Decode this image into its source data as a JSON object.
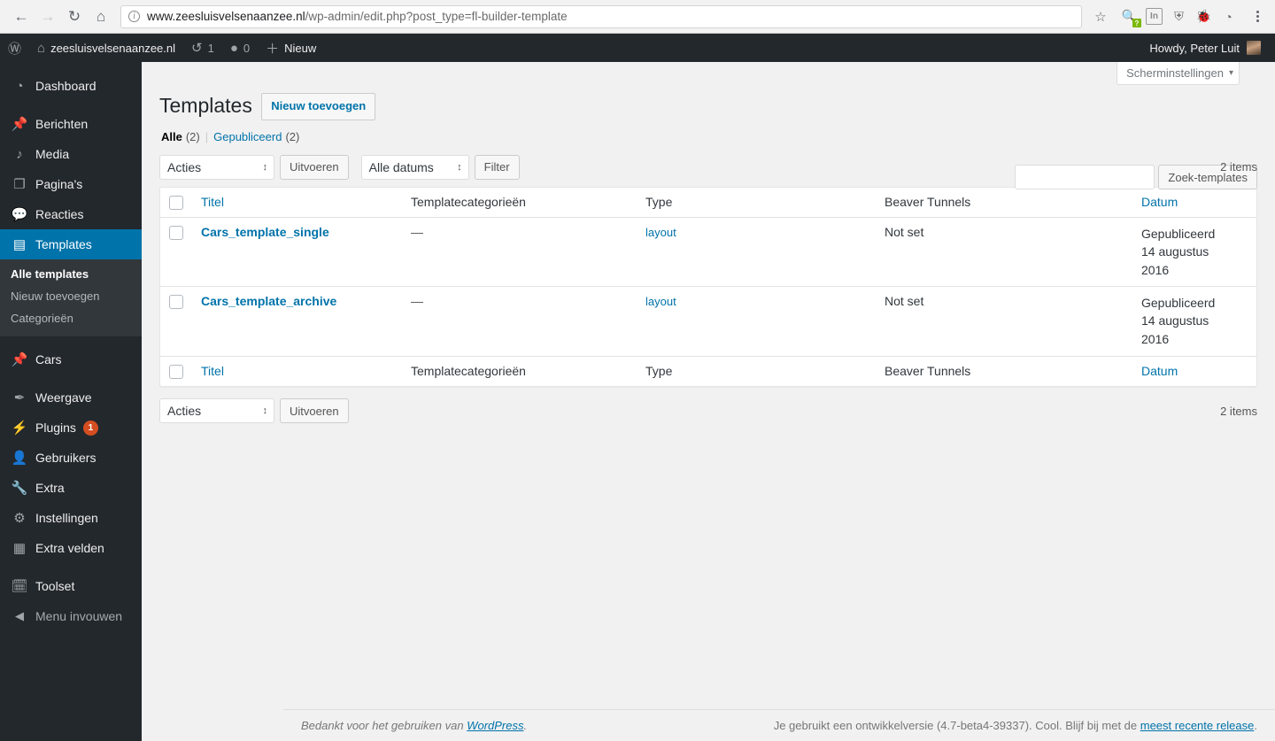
{
  "browser": {
    "back_icon": "←",
    "forward_icon": "→",
    "reload_icon": "↻",
    "home_icon": "⌂",
    "info_icon": "i",
    "url_host": "www.zeesluisvelsenaanzee.nl",
    "url_path": "/wp-admin/edit.php?post_type=fl-builder-template",
    "star_icon": "☆",
    "extensions": [
      {
        "name": "magnifier-extension-icon",
        "glyph": "🔍",
        "badge": "?"
      },
      {
        "name": "linkedin-extension-icon",
        "glyph": "In",
        "badge": ""
      },
      {
        "name": "shield-extension-icon",
        "glyph": "⛨",
        "badge": ""
      },
      {
        "name": "bug-extension-icon",
        "glyph": "🐞",
        "badge": ""
      },
      {
        "name": "globe-extension-icon",
        "glyph": "◔",
        "badge": ""
      }
    ]
  },
  "adminbar": {
    "wp_logo_icon": "Ⓦ",
    "home_icon": "⌂",
    "site_name": "zeesluisvelsenaanzee.nl",
    "updates_icon": "↺",
    "updates_count": "1",
    "comments_icon": "●",
    "comments_count": "0",
    "new_icon": "＋",
    "new_label": "Nieuw",
    "howdy": "Howdy, Peter Luit"
  },
  "sidebar": {
    "items": [
      {
        "label": "Dashboard",
        "icon": "dashboard-icon",
        "glyph": "◔",
        "current": false,
        "gap_after": true
      },
      {
        "label": "Berichten",
        "icon": "pin-icon",
        "glyph": "📌",
        "current": false
      },
      {
        "label": "Media",
        "icon": "media-icon",
        "glyph": "♪",
        "current": false
      },
      {
        "label": "Pagina's",
        "icon": "page-icon",
        "glyph": "❐",
        "current": false
      },
      {
        "label": "Reacties",
        "icon": "comment-icon",
        "glyph": "💬",
        "current": false
      },
      {
        "label": "Templates",
        "icon": "templates-icon",
        "glyph": "▤",
        "current": true
      }
    ],
    "submenu": [
      {
        "label": "Alle templates",
        "current": true
      },
      {
        "label": "Nieuw toevoegen",
        "current": false
      },
      {
        "label": "Categorieën",
        "current": false
      }
    ],
    "items2": [
      {
        "label": "Cars",
        "icon": "pin-icon",
        "glyph": "📌",
        "badge": ""
      },
      {
        "label": "Weergave",
        "icon": "appearance-brush-icon",
        "glyph": "✒",
        "badge": "",
        "gap_before": true
      },
      {
        "label": "Plugins",
        "icon": "plugin-icon",
        "glyph": "⚡",
        "badge": "1"
      },
      {
        "label": "Gebruikers",
        "icon": "user-icon",
        "glyph": "👤",
        "badge": ""
      },
      {
        "label": "Extra",
        "icon": "tools-wrench-icon",
        "glyph": "🔧",
        "badge": ""
      },
      {
        "label": "Instellingen",
        "icon": "settings-sliders-icon",
        "glyph": "⚙",
        "badge": ""
      },
      {
        "label": "Extra velden",
        "icon": "custom-fields-icon",
        "glyph": "▦",
        "badge": ""
      },
      {
        "label": "Toolset",
        "icon": "toolset-icon",
        "glyph": "🗓",
        "badge": "",
        "gap_before": true
      },
      {
        "label": "Menu invouwen",
        "icon": "collapse-arrow-icon",
        "glyph": "◀",
        "badge": "",
        "collapse": true
      }
    ]
  },
  "screen_options": {
    "label": "Scherminstellingen",
    "caret": "▾"
  },
  "page": {
    "title": "Templates",
    "add_new_label": "Nieuw toevoegen"
  },
  "views": {
    "all_label": "Alle",
    "all_count": "(2)",
    "separator": "|",
    "published_label": "Gepubliceerd",
    "published_count": "(2)"
  },
  "search": {
    "value": "",
    "placeholder": "",
    "button_label": "Zoek-templates"
  },
  "tablenav_top": {
    "bulk_action": "Acties",
    "apply_label": "Uitvoeren",
    "date_filter": "Alle datums",
    "filter_label": "Filter",
    "displaying_num": "2 items"
  },
  "tablenav_bottom": {
    "bulk_action": "Acties",
    "apply_label": "Uitvoeren",
    "displaying_num": "2 items"
  },
  "table": {
    "columns": [
      {
        "label": "Titel",
        "link": true
      },
      {
        "label": "Templatecategorieën",
        "link": false
      },
      {
        "label": "Type",
        "link": false
      },
      {
        "label": "Beaver Tunnels",
        "link": false
      },
      {
        "label": "Datum",
        "link": true
      }
    ],
    "rows": [
      {
        "title": "Cars_template_single",
        "categories": "—",
        "type": "layout",
        "beaver_tunnels": "Not set",
        "date_status": "Gepubliceerd",
        "date_day": "14 augustus",
        "date_year": "2016"
      },
      {
        "title": "Cars_template_archive",
        "categories": "—",
        "type": "layout",
        "beaver_tunnels": "Not set",
        "date_status": "Gepubliceerd",
        "date_day": "14 augustus",
        "date_year": "2016"
      }
    ]
  },
  "footer": {
    "thanks_prefix": "Bedankt voor het gebruiken van ",
    "wordpress_link": "WordPress",
    "thanks_suffix": ".",
    "version_text": "Je gebruikt een ontwikkelversie (4.7-beta4-39337). Cool. Blijf bij met de ",
    "release_link": "meest recente release",
    "version_suffix": "."
  },
  "colors": {
    "wp_blue": "#0073aa",
    "sidebar_bg": "#23282d",
    "submenu_bg": "#32373c",
    "content_bg": "#f1f1f1",
    "badge_orange": "#d54e21"
  }
}
